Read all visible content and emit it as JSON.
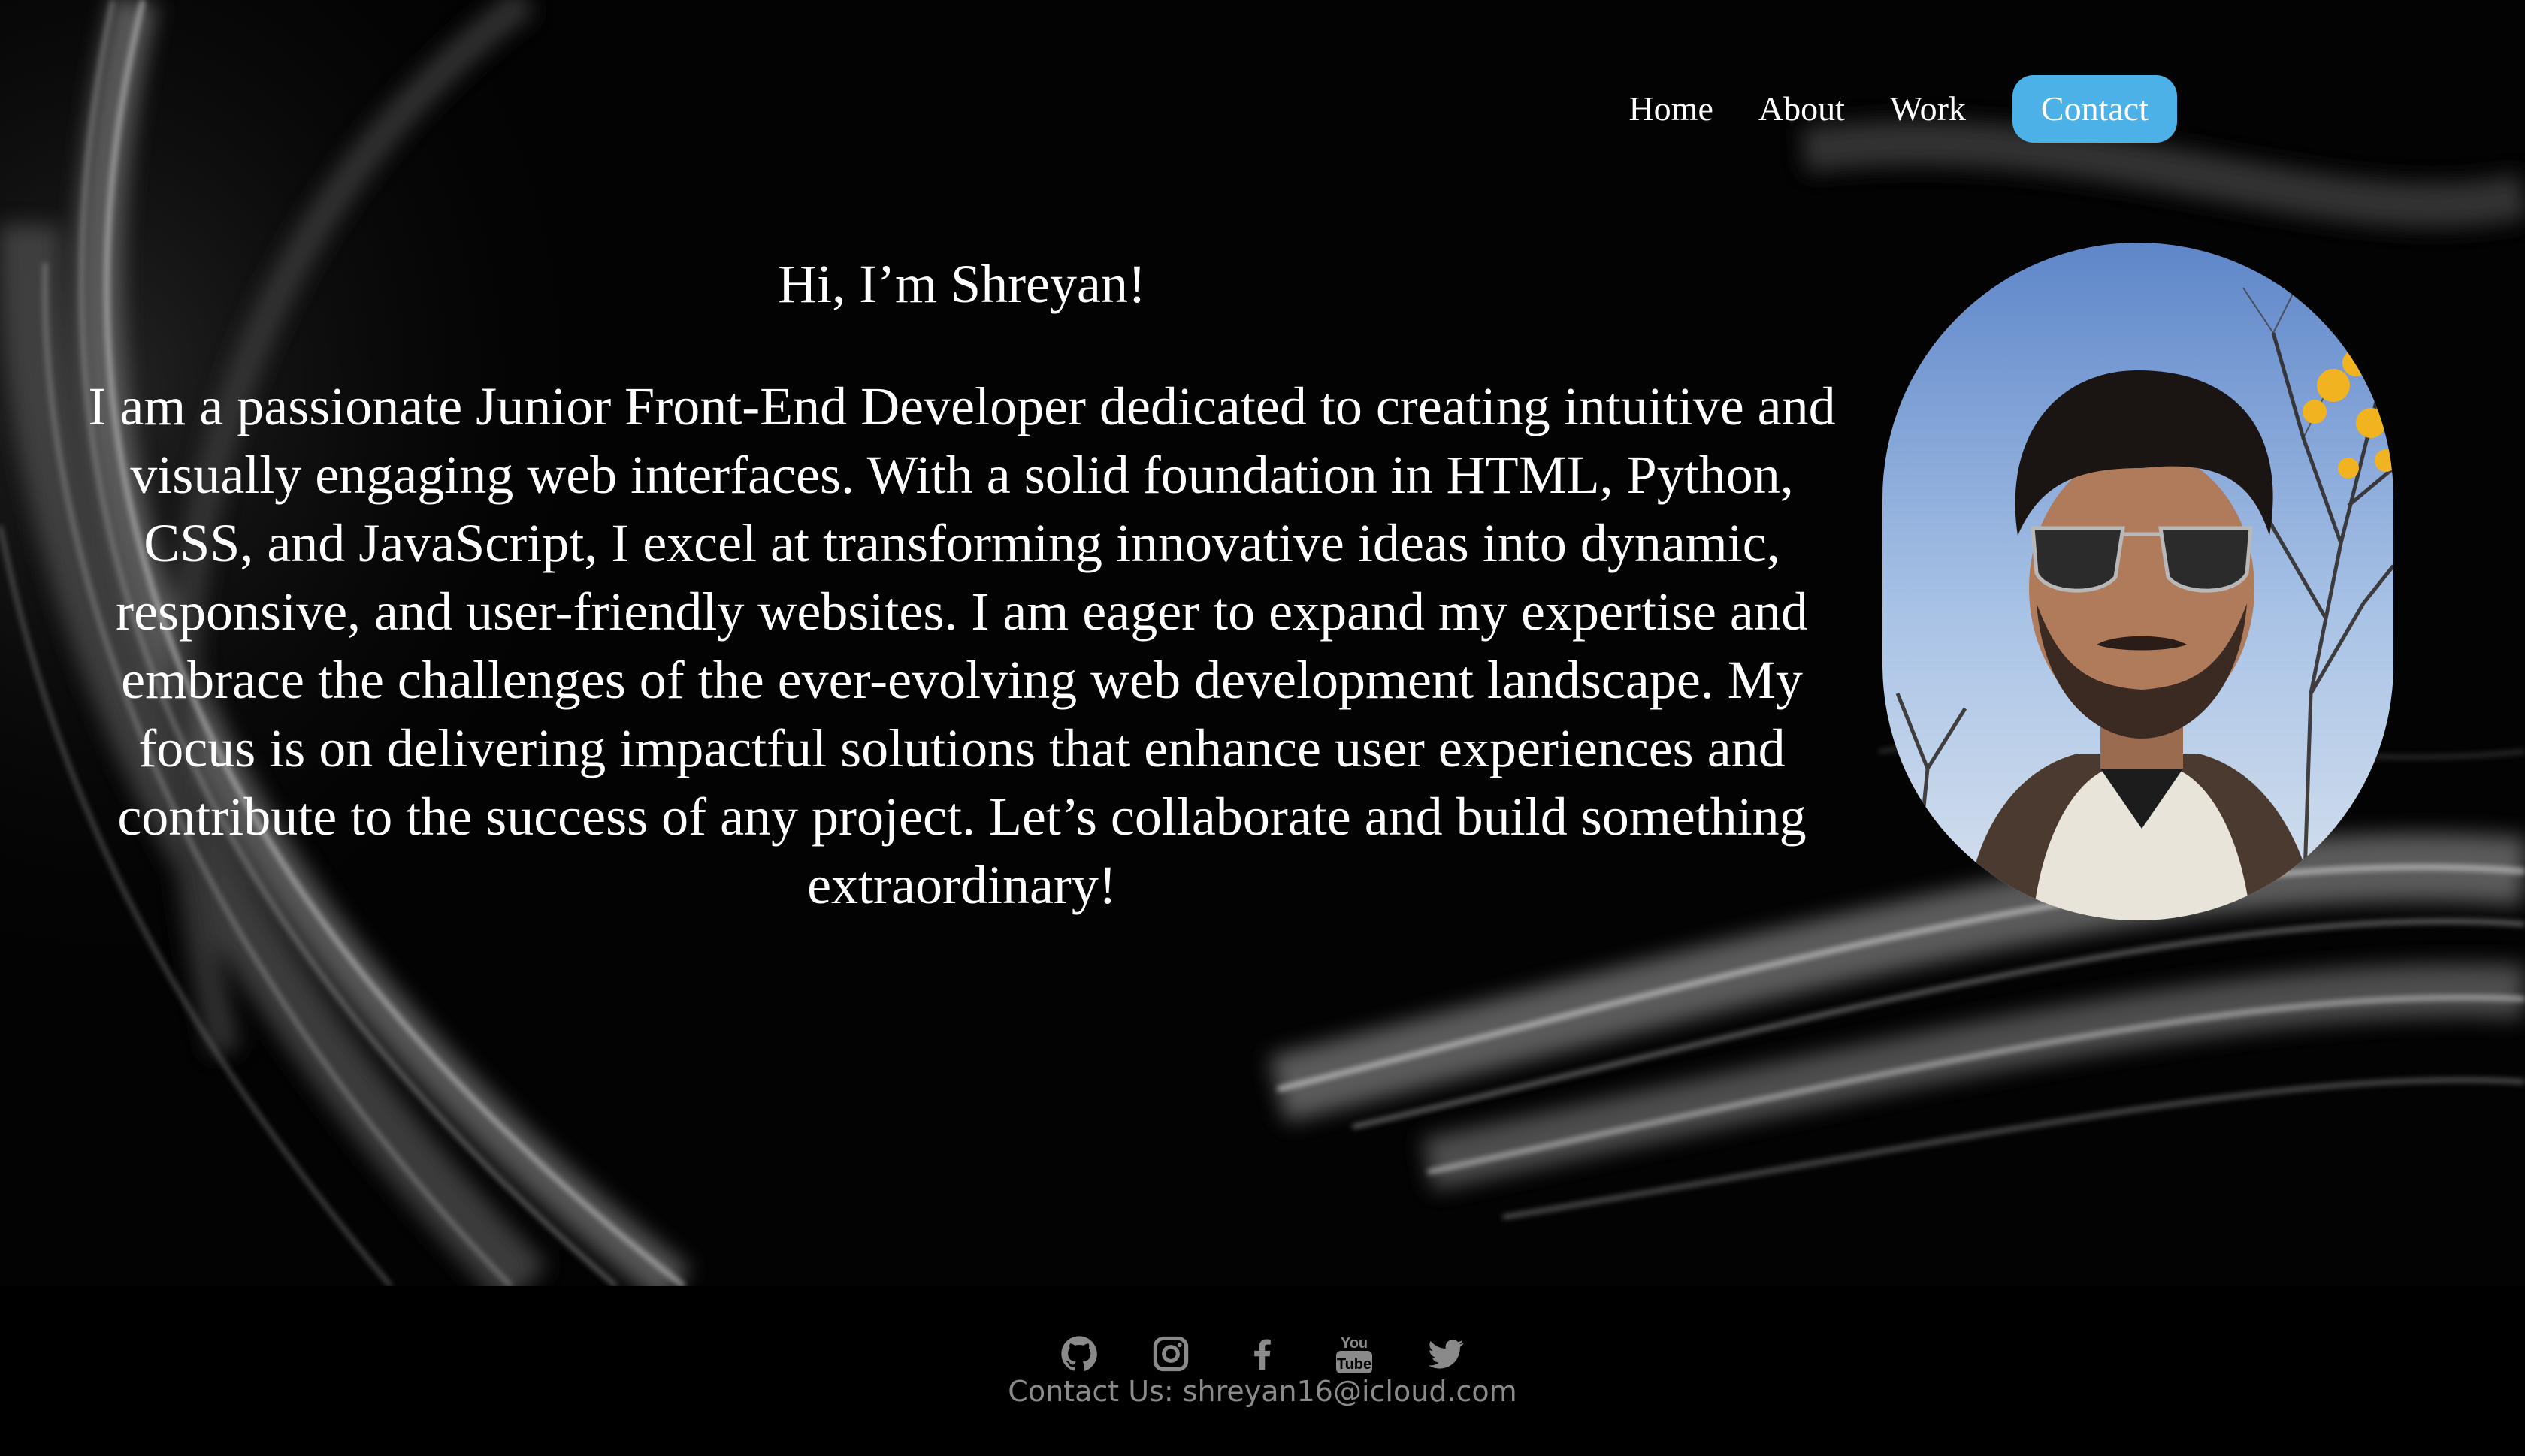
{
  "nav": {
    "items": [
      {
        "label": "Home"
      },
      {
        "label": "About"
      },
      {
        "label": "Work"
      }
    ],
    "contact_label": "Contact"
  },
  "intro": {
    "greeting": "Hi, I’m Shreyan!",
    "bio": "I am a passionate Junior Front-End Developer dedicated to creating intuitive and visually engaging web interfaces. With a solid foundation in HTML, Python, CSS, and JavaScript, I excel at transforming innovative ideas into dynamic, responsive, and user-friendly websites. I am eager to expand my expertise and embrace the challenges of the ever-evolving web development landscape. My focus is on delivering impactful solutions that enhance user experiences and contribute to the success of any project. Let’s collaborate and build something extraordinary!"
  },
  "footer": {
    "social": [
      "github-icon",
      "instagram-icon",
      "facebook-icon",
      "youtube-icon",
      "twitter-icon"
    ],
    "contact_text": "Contact Us: shreyan16@icloud.com"
  },
  "colors": {
    "accent": "#4bb1e6",
    "background": "#000000",
    "footer_text": "#8a8a8a"
  }
}
